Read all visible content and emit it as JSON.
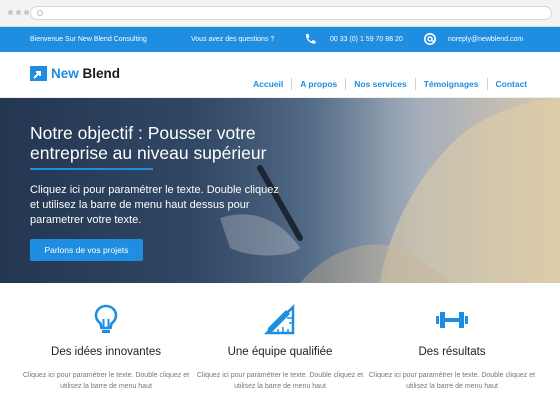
{
  "topbar": {
    "welcome": "Bienvenue Sur New Blend  Consulting",
    "question": "Vous avez des questions ?",
    "phone": "00 33 (0) 1 59 70 88 20",
    "email": "noreply@newblend.com"
  },
  "logo": {
    "part1": "New",
    "part2": "Blend"
  },
  "menu": [
    "Accueil",
    "A propos",
    "Nos services",
    "Témoignages",
    "Contact"
  ],
  "hero": {
    "title": "Notre objectif : Pousser votre entreprise au niveau supérieur",
    "text": "Cliquez ici pour paramétrer le texte. Double cliquez et utilisez la barre de menu haut dessus pour parametrer votre texte.",
    "button": "Parlons de vos projets"
  },
  "features": [
    {
      "icon": "lightbulb-icon",
      "title": "Des idées innovantes",
      "text": "Cliquez ici pour paramétrer le texte. Double cliquez et utilisez la barre de menu haut"
    },
    {
      "icon": "pencil-ruler-icon",
      "title": "Une équipe qualifiée",
      "text": "Cliquez ici pour paramétrer le texte. Double cliquez et utilisez la barre de menu haut"
    },
    {
      "icon": "dumbbell-icon",
      "title": "Des résultats",
      "text": "Cliquez ici pour paramétrer le texte. Double cliquez et utilisez la barre de menu haut"
    }
  ],
  "colors": {
    "accent": "#1f8de0"
  }
}
